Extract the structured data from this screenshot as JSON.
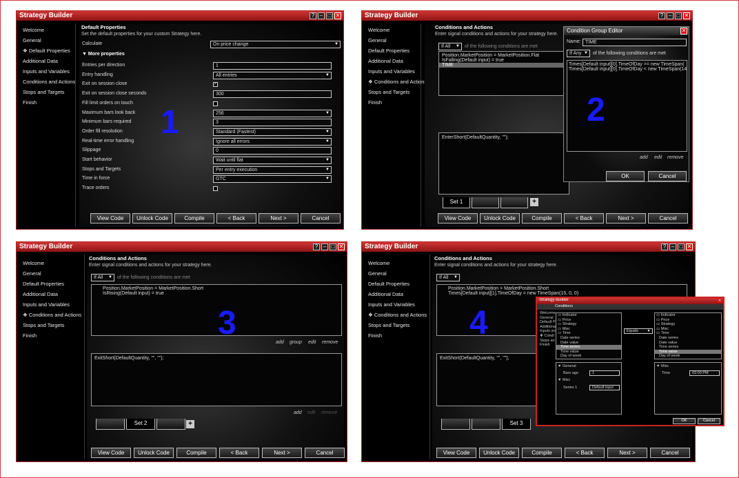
{
  "window_title": "Strategy Builder",
  "title_btns": [
    "?",
    "–",
    "□",
    "✕"
  ],
  "nav": [
    "Welcome",
    "General",
    "Default Properties",
    "Additional Data",
    "Inputs and Variables",
    "Conditions and Actions",
    "Stops and Targets",
    "Finish"
  ],
  "bottom_buttons": [
    "View Code",
    "Unlock Code",
    "Compile",
    "< Back",
    "Next >",
    "Cancel"
  ],
  "p1": {
    "number": "1",
    "heading": "Default Properties",
    "desc": "Set the default properties for your custom Strategy here.",
    "calc_label": "Calculate",
    "calc_value": "On price change",
    "more": "More properties",
    "rows": [
      {
        "label": "Entries per direction",
        "value": "1",
        "type": "text"
      },
      {
        "label": "Entry handling",
        "value": "All entries",
        "type": "select"
      },
      {
        "label": "Exit on session close",
        "value": "✓",
        "type": "check"
      },
      {
        "label": "Exit on session close seconds",
        "value": "300",
        "type": "text"
      },
      {
        "label": "Fill limit orders on touch",
        "value": "",
        "type": "check"
      },
      {
        "label": "Maximum bars look back",
        "value": "256",
        "type": "select"
      },
      {
        "label": "Minimum bars required",
        "value": "3",
        "type": "text"
      },
      {
        "label": "Order fill resolution",
        "value": "Standard (Fastest)",
        "type": "select"
      },
      {
        "label": "Real-time error handling",
        "value": "Ignore all errors",
        "type": "select"
      },
      {
        "label": "Slippage",
        "value": "0",
        "type": "text"
      },
      {
        "label": "Start behavior",
        "value": "Wait until flat",
        "type": "select"
      },
      {
        "label": "Stops and Targets",
        "value": "Per entry execution",
        "type": "select"
      },
      {
        "label": "Time in force",
        "value": "GTC",
        "type": "select"
      },
      {
        "label": "Trace orders",
        "value": "",
        "type": "check"
      }
    ]
  },
  "p2": {
    "number": "2",
    "heading": "Conditions and Actions",
    "desc": "Enter signal conditions and actions for your strategy here.",
    "if_all": "If All",
    "cond_suffix": "of the following conditions are met",
    "conds": [
      "Position.MarketPosition = MarketPosition.Flat",
      "IsFalling(Default input) = true",
      "TIME"
    ],
    "action": "EnterShort(DefaultQuantity, \"\");",
    "set": "Set 1",
    "plus": "+",
    "editor": {
      "title": "Condition Group Editor",
      "name_label": "Name:",
      "name_value": "TIME",
      "if_any": "If Any",
      "suffix": "of the following conditions are met",
      "conds": [
        "Times[Default input][0].TimeOfDay >= new TimeSpan(",
        "Times[Default input][0].TimeOfDay < new TimeSpan(14"
      ],
      "add": "add",
      "edit": "edit",
      "remove": "remove",
      "ok": "OK",
      "cancel": "Cancel"
    }
  },
  "p3": {
    "number": "3",
    "heading": "Conditions and Actions",
    "desc": "Enter signal conditions and actions for your strategy here.",
    "if_all": "If All",
    "cond_suffix": "of the following conditions are met",
    "conds": [
      "Position.MarketPosition = MarketPosition.Short",
      "IsRising(Default input) = true"
    ],
    "links": [
      "add",
      "group",
      "edit",
      "remove"
    ],
    "action": "ExitShort(DefaultQuantity, \"\", \"\");",
    "links2": [
      "add",
      "edit",
      "remove"
    ],
    "set": "Set 2",
    "plus": "+"
  },
  "p4": {
    "number": "4",
    "heading": "Conditions and Actions",
    "desc": "Enter signal conditions and actions for your strategy here.",
    "if_all": "If All",
    "conds": [
      "Position.MarketPosition = MarketPosition.Short",
      "Times[Default input][1].TimeOfDay = new TimeSpan(15, 0, 0)"
    ],
    "action": "ExitShort(DefaultQuantity, \"\", \"\");",
    "set": "Set 3",
    "dialog": {
      "title": "Strategy Builder",
      "sub": "Conditions",
      "nav": [
        "Welcome",
        "General",
        "Default P",
        "Additional",
        "Inputs an",
        "Condi",
        "Stops an",
        "Finish"
      ],
      "left_tree": [
        "Indicator",
        "Price",
        "Strategy",
        "Misc",
        "Time",
        "Date series",
        "Date value",
        "Time series",
        "Time value",
        "Day of week"
      ],
      "right_tree": [
        "Indicator",
        "Price",
        "Strategy",
        "Misc",
        "Time",
        "Date series",
        "Date value",
        "Time series",
        "Time value",
        "Day of week"
      ],
      "op": "Equals",
      "general": "General",
      "bars_ago_label": "Bars ago",
      "bars_ago": "1",
      "misc": "Misc",
      "series_label": "Series 1",
      "series": "Default input",
      "misc2": "Misc",
      "time_label": "Time",
      "time": "03:00 PM",
      "ok": "OK",
      "cancel": "Cancel"
    }
  }
}
